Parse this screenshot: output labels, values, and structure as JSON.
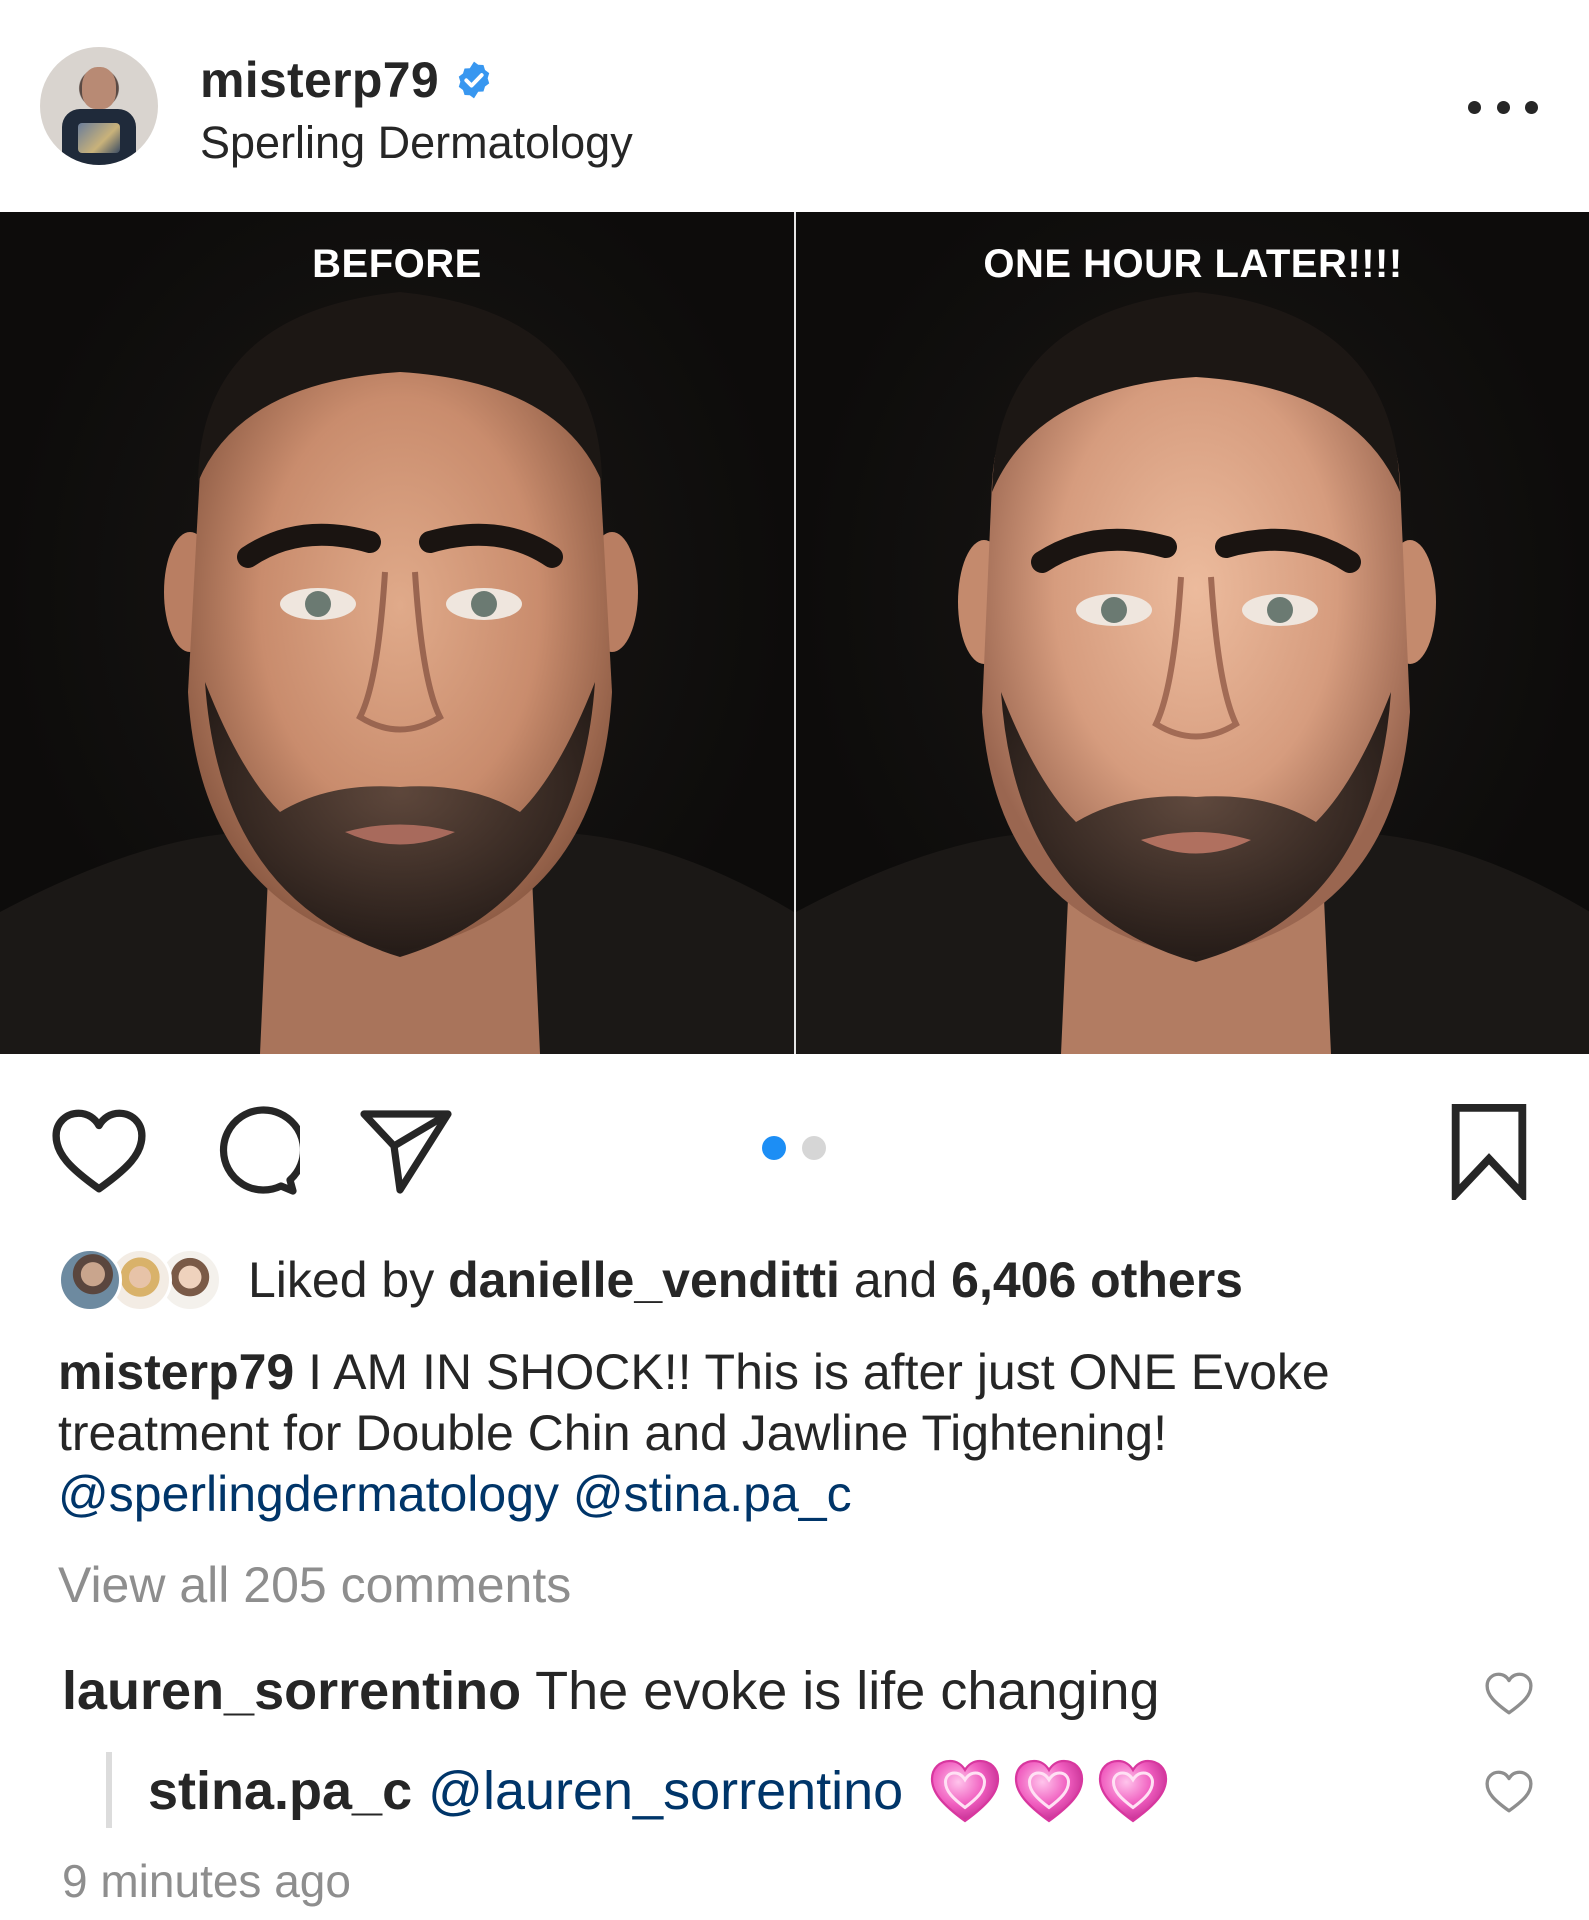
{
  "post": {
    "username": "misterp79",
    "verified": true,
    "location": "Sperling Dermatology",
    "more_icon": "more-horizontal-icon"
  },
  "media": {
    "left_label": "BEFORE",
    "right_label": "ONE HOUR LATER!!!!",
    "carousel": {
      "total": 2,
      "active": 1
    }
  },
  "actions": {
    "like_icon": "heart-outline-icon",
    "comment_icon": "comment-bubble-icon",
    "share_icon": "paper-plane-icon",
    "save_icon": "bookmark-outline-icon"
  },
  "likes": {
    "prefix": "Liked by",
    "first_user": "danielle_venditti",
    "conjunction": "and",
    "others": "6,406 others"
  },
  "caption": {
    "username": "misterp79",
    "text": "I AM IN SHOCK!! This is after just ONE Evoke treatment for Double Chin and Jawline Tightening!",
    "mention_1": "@sperlingdermatology",
    "mention_2": "@stina.pa_c"
  },
  "view_comments": "View all 205 comments",
  "comments": [
    {
      "username": "lauren_sorrentino",
      "text": "The evoke is life changing"
    },
    {
      "username": "stina.pa_c",
      "mention": "@lauren_sorrentino",
      "emoji": "sparkling-heart-emoji x3"
    }
  ],
  "timestamp": "9 minutes ago",
  "colors": {
    "text": "#262626",
    "muted": "#8e8e8e",
    "mention": "#003569",
    "verified_blue": "#3897f0",
    "active_dot": "#1c8ef5",
    "inactive_dot": "#d6d6d6",
    "heart_pink": "#e84cb4"
  }
}
